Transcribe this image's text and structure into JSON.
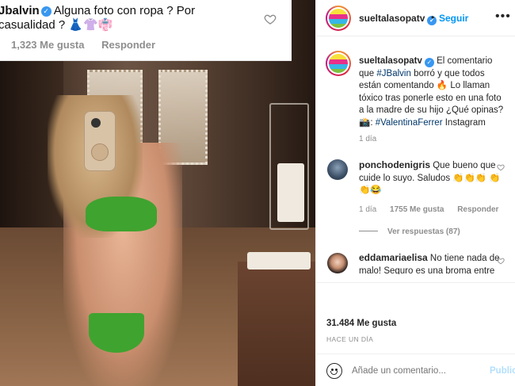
{
  "overlay_comment": {
    "username": "Jbalvin",
    "text_line1": "Alguna foto con ropa ? Por",
    "text_line2": "casualidad ?",
    "emojis": "👗👚👘",
    "likes": "1,323 Me gusta",
    "reply": "Responder"
  },
  "header": {
    "username": "sueltalasopatv",
    "separator": "•",
    "follow": "Seguir",
    "more": "•••"
  },
  "caption": {
    "username": "sueltalasopatv",
    "text_before_tag": "El comentario que",
    "tag1": "#JBalvin",
    "text_mid": "borró y que todos están comentando 🔥 Lo llaman tóxico tras ponerle esto en una foto a la madre de su hijo ¿Qué opinas? 📸:",
    "tag2": "#ValentinaFerrer",
    "text_after": "Instagram",
    "time": "1 día"
  },
  "comments": [
    {
      "username": "ponchodenigris",
      "text": "Que bueno que cuide lo suyo. Saludos 👏👏👏 👏👏😂",
      "time": "1 día",
      "likes": "1755 Me gusta",
      "reply": "Responder",
      "view_replies": "Ver respuestas (87)"
    },
    {
      "username": "eddamariaelisa",
      "text": "No tiene nada de malo! Seguro es una broma entre ellos! Los amo a todos"
    }
  ],
  "post": {
    "likes": "31.484 Me gusta",
    "ago": "HACE UN DÍA"
  },
  "add_comment": {
    "placeholder": "Añade un comentario...",
    "publish": "Publicar"
  },
  "colors": {
    "link_blue": "#0095f6",
    "hashtag": "#00376b",
    "muted": "#8e8e8e"
  }
}
